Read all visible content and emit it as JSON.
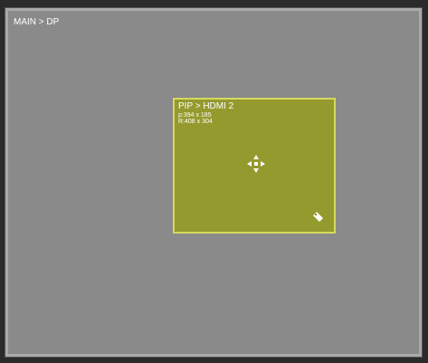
{
  "main": {
    "label": "MAIN > DP"
  },
  "pip": {
    "title": "PIP > HDMI 2",
    "position": "p:394 x 185",
    "resolution": "R:408 x 304",
    "move_icon": "move-arrows-icon",
    "resize_icon": "tag-icon",
    "fill_color": "#949a2e",
    "border_color": "#d6d95c"
  },
  "colors": {
    "canvas": "#8a8a8a",
    "background": "#2b2b2b"
  }
}
